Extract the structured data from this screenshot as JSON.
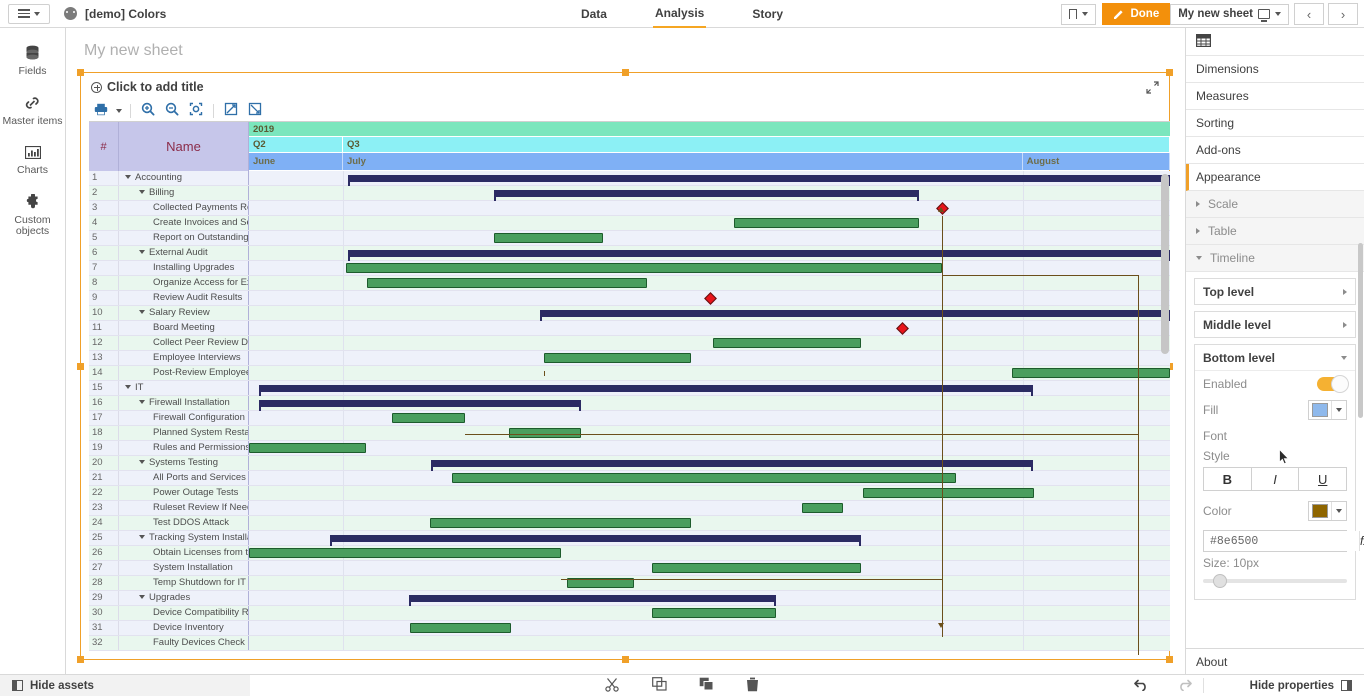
{
  "topbar": {
    "menu_icon": "hamburger-icon",
    "app_icon": "app-logo-icon",
    "app_title": "[demo] Colors",
    "nav": [
      {
        "label": "Data",
        "active": false
      },
      {
        "label": "Analysis",
        "active": true
      },
      {
        "label": "Story",
        "active": false
      }
    ],
    "bookmark_label": "",
    "done_label": "Done",
    "sheet_label": "My new sheet",
    "prev_label": "‹",
    "next_label": "›"
  },
  "rail": {
    "items": [
      {
        "label": "Fields",
        "icon": "database-icon"
      },
      {
        "label": "Master items",
        "icon": "link-icon"
      },
      {
        "label": "Charts",
        "icon": "bar-chart-icon"
      },
      {
        "label": "Custom objects",
        "icon": "puzzle-icon"
      }
    ]
  },
  "sheet": {
    "title": "My new sheet",
    "object_title": "Click to add title"
  },
  "gantt_toolbar": {
    "buttons": [
      {
        "name": "print-button",
        "icon": "printer-icon"
      },
      {
        "name": "zoom-in-button",
        "icon": "zoom-in-icon"
      },
      {
        "name": "zoom-out-button",
        "icon": "zoom-out-icon"
      },
      {
        "name": "fit-button",
        "icon": "fit-screen-icon"
      },
      {
        "name": "expand-all-button",
        "icon": "expand-all-icon"
      },
      {
        "name": "collapse-all-button",
        "icon": "collapse-all-icon"
      }
    ]
  },
  "chart_data": {
    "type": "bar",
    "subtype": "gantt",
    "title": "",
    "columns": [
      "#",
      "Name"
    ],
    "timeline": {
      "top_level": [
        {
          "label": "2019",
          "start": 0,
          "end": 1
        }
      ],
      "middle_level": [
        {
          "label": "Q2",
          "start": 0,
          "end": 0.102
        },
        {
          "label": "Q3",
          "start": 0.102,
          "end": 1
        }
      ],
      "bottom_level": [
        {
          "label": "June",
          "start": 0,
          "end": 0.102
        },
        {
          "label": "July",
          "start": 0.102,
          "end": 0.84
        },
        {
          "label": "August",
          "start": 0.84,
          "end": 1
        }
      ]
    },
    "xlabel": "",
    "ylabel": "",
    "rows": [
      {
        "n": 1,
        "name": "Accounting",
        "indent": 0,
        "collapsible": true,
        "type": "summary",
        "start": 0.107,
        "end": 1.0
      },
      {
        "n": 2,
        "name": "Billing",
        "indent": 1,
        "collapsible": true,
        "type": "summary",
        "start": 0.266,
        "end": 0.727
      },
      {
        "n": 3,
        "name": "Collected Payments Review",
        "indent": 2,
        "collapsible": false,
        "type": "milestone",
        "start": 0.752
      },
      {
        "n": 4,
        "name": "Create Invoices and Send Invoices",
        "indent": 2,
        "collapsible": false,
        "type": "task",
        "start": 0.527,
        "end": 0.728
      },
      {
        "n": 5,
        "name": "Report on Outstanding Collections",
        "indent": 2,
        "collapsible": false,
        "type": "task",
        "start": 0.266,
        "end": 0.384
      },
      {
        "n": 6,
        "name": "External Audit",
        "indent": 1,
        "collapsible": true,
        "type": "summary",
        "start": 0.107,
        "end": 1.0
      },
      {
        "n": 7,
        "name": "Installing Upgrades",
        "indent": 2,
        "collapsible": false,
        "type": "task",
        "start": 0.105,
        "end": 0.752
      },
      {
        "n": 8,
        "name": "Organize Access for External Auditors",
        "indent": 2,
        "collapsible": false,
        "type": "task",
        "start": 0.128,
        "end": 0.432
      },
      {
        "n": 9,
        "name": "Review Audit Results",
        "indent": 2,
        "collapsible": false,
        "type": "milestone",
        "start": 0.5
      },
      {
        "n": 10,
        "name": "Salary Review",
        "indent": 1,
        "collapsible": true,
        "type": "summary",
        "start": 0.316,
        "end": 1.0
      },
      {
        "n": 11,
        "name": "Board Meeting",
        "indent": 2,
        "collapsible": false,
        "type": "milestone",
        "start": 0.709
      },
      {
        "n": 12,
        "name": "Collect Peer Review Data",
        "indent": 2,
        "collapsible": false,
        "type": "task",
        "start": 0.504,
        "end": 0.665
      },
      {
        "n": 13,
        "name": "Employee Interviews",
        "indent": 2,
        "collapsible": false,
        "type": "task",
        "start": 0.32,
        "end": 0.48
      },
      {
        "n": 14,
        "name": "Post-Review Employee Interviews",
        "indent": 2,
        "collapsible": false,
        "type": "task",
        "start": 0.828,
        "end": 1.0
      },
      {
        "n": 15,
        "name": "IT",
        "indent": 0,
        "collapsible": true,
        "type": "summary",
        "start": 0.011,
        "end": 0.851
      },
      {
        "n": 16,
        "name": "Firewall Installation",
        "indent": 1,
        "collapsible": true,
        "type": "summary",
        "start": 0.011,
        "end": 0.36
      },
      {
        "n": 17,
        "name": "Firewall Configuration",
        "indent": 2,
        "collapsible": false,
        "type": "task",
        "start": 0.155,
        "end": 0.234
      },
      {
        "n": 18,
        "name": "Planned System Restart",
        "indent": 2,
        "collapsible": false,
        "type": "task",
        "start": 0.282,
        "end": 0.36
      },
      {
        "n": 19,
        "name": "Rules and Permissions Audit",
        "indent": 2,
        "collapsible": false,
        "type": "task",
        "start": 0.0,
        "end": 0.127
      },
      {
        "n": 20,
        "name": "Systems Testing",
        "indent": 1,
        "collapsible": true,
        "type": "summary",
        "start": 0.198,
        "end": 0.851
      },
      {
        "n": 21,
        "name": "All Ports and Services Testing",
        "indent": 2,
        "collapsible": false,
        "type": "task",
        "start": 0.22,
        "end": 0.768
      },
      {
        "n": 22,
        "name": "Power Outage Tests",
        "indent": 2,
        "collapsible": false,
        "type": "task",
        "start": 0.667,
        "end": 0.852
      },
      {
        "n": 23,
        "name": "Ruleset Review If Needed",
        "indent": 2,
        "collapsible": false,
        "type": "task",
        "start": 0.6,
        "end": 0.645
      },
      {
        "n": 24,
        "name": "Test DDOS Attack",
        "indent": 2,
        "collapsible": false,
        "type": "task",
        "start": 0.197,
        "end": 0.48
      },
      {
        "n": 25,
        "name": "Tracking System Installation",
        "indent": 1,
        "collapsible": true,
        "type": "summary",
        "start": 0.088,
        "end": 0.665
      },
      {
        "n": 26,
        "name": "Obtain Licenses from the Vendor",
        "indent": 2,
        "collapsible": false,
        "type": "task",
        "start": 0.0,
        "end": 0.339
      },
      {
        "n": 27,
        "name": "System Installation",
        "indent": 2,
        "collapsible": false,
        "type": "task",
        "start": 0.438,
        "end": 0.665
      },
      {
        "n": 28,
        "name": "Temp Shutdown for IT Audit",
        "indent": 2,
        "collapsible": false,
        "type": "task",
        "start": 0.345,
        "end": 0.418
      },
      {
        "n": 29,
        "name": "Upgrades",
        "indent": 1,
        "collapsible": true,
        "type": "summary",
        "start": 0.174,
        "end": 0.572
      },
      {
        "n": 30,
        "name": "Device Compatibility Review",
        "indent": 2,
        "collapsible": false,
        "type": "task",
        "start": 0.438,
        "end": 0.572
      },
      {
        "n": 31,
        "name": "Device Inventory",
        "indent": 2,
        "collapsible": false,
        "type": "task",
        "start": 0.175,
        "end": 0.285
      },
      {
        "n": 32,
        "name": "Faulty Devices Check",
        "indent": 2,
        "collapsible": false,
        "type": "task",
        "start": 0.0,
        "end": 0.0
      }
    ],
    "colors": {
      "summary_bar": "#2b2b63",
      "task_bar": "#4a9e5e",
      "task_border": "#1d5c2c",
      "milestone": "#e8141b",
      "dependency": "#6b4f1b",
      "year_header": "#7be6bd",
      "quarter_header": "#8cf0f5",
      "month_header": "#7fb0f5",
      "row_even": "#eef1fa",
      "row_odd": "#e9f7ee"
    },
    "legend": []
  },
  "properties": {
    "header_icon": "table-chart-icon",
    "sections": [
      {
        "label": "Dimensions",
        "active": false
      },
      {
        "label": "Measures",
        "active": false
      },
      {
        "label": "Sorting",
        "active": false
      },
      {
        "label": "Add-ons",
        "active": false
      },
      {
        "label": "Appearance",
        "active": true
      }
    ],
    "subsections": [
      {
        "label": "Scale",
        "expanded": false
      },
      {
        "label": "Table",
        "expanded": false
      },
      {
        "label": "Timeline",
        "expanded": true
      }
    ],
    "timeline_levels": [
      {
        "label": "Top level",
        "expanded": false
      },
      {
        "label": "Middle level",
        "expanded": false
      },
      {
        "label": "Bottom level",
        "expanded": true
      }
    ],
    "bottom_level": {
      "enabled_label": "Enabled",
      "enabled_value": true,
      "fill_label": "Fill",
      "fill_color": "#8fb9ec",
      "font_label": "Font",
      "style_label": "Style",
      "style_bold": "B",
      "style_italic": "I",
      "style_underline": "U",
      "color_label": "Color",
      "color_value": "#8e6500",
      "color_input": "#8e6500",
      "fx_label": "fx",
      "size_label": "Size: 10px"
    },
    "about_label": "About"
  },
  "bottombar": {
    "hide_assets": "Hide assets",
    "tools": [
      {
        "name": "cut-button",
        "icon": "scissors-icon"
      },
      {
        "name": "copy-button",
        "icon": "copy-icon"
      },
      {
        "name": "paste-button",
        "icon": "paste-icon"
      },
      {
        "name": "delete-button",
        "icon": "trash-icon"
      }
    ],
    "undo": "undo-icon",
    "redo": "redo-icon",
    "hide_properties": "Hide properties"
  }
}
